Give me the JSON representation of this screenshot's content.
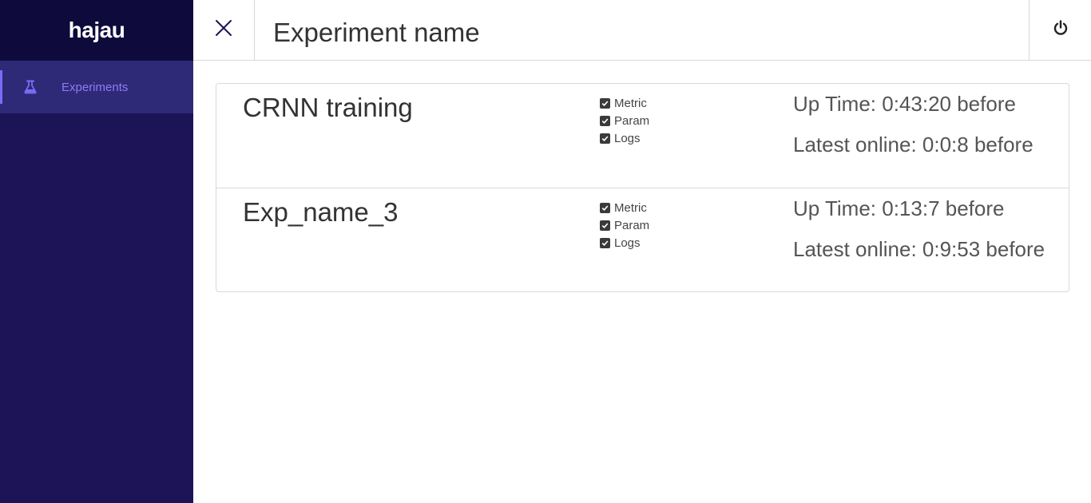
{
  "sidebar": {
    "brand": "hajau",
    "items": [
      {
        "label": "Experiments",
        "icon": "flask-icon",
        "active": true
      }
    ]
  },
  "header": {
    "title": "Experiment name",
    "close_icon": "close-icon",
    "power_icon": "power-icon"
  },
  "experiments": [
    {
      "name": "CRNN training",
      "checks": [
        "Metric",
        "Param",
        "Logs"
      ],
      "up_time": "Up Time: 0:43:20 before",
      "latest_online": "Latest online: 0:0:8 before"
    },
    {
      "name": "Exp_name_3",
      "checks": [
        "Metric",
        "Param",
        "Logs"
      ],
      "up_time": "Up Time: 0:13:7 before",
      "latest_online": "Latest online: 0:9:53 before"
    }
  ],
  "colors": {
    "sidebar_bg": "#1c1457",
    "brand_bg": "#0f0a3c",
    "nav_active_bg": "#2e2a78",
    "accent": "#7b6cf6",
    "border": "#d9d9d9"
  }
}
